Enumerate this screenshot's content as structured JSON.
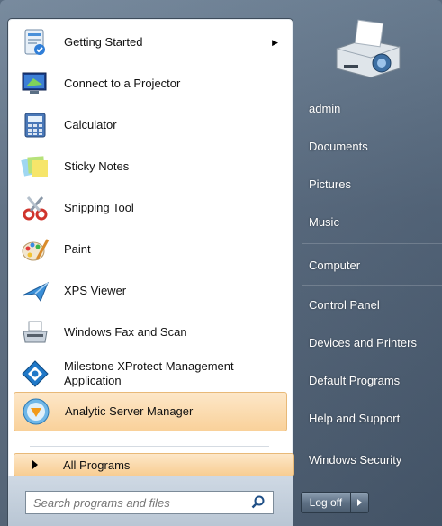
{
  "programs": [
    {
      "label": "Getting Started",
      "icon": "getting-started-icon",
      "has_submenu": true
    },
    {
      "label": "Connect to a Projector",
      "icon": "projector-icon"
    },
    {
      "label": "Calculator",
      "icon": "calculator-icon"
    },
    {
      "label": "Sticky Notes",
      "icon": "sticky-notes-icon"
    },
    {
      "label": "Snipping Tool",
      "icon": "snipping-tool-icon"
    },
    {
      "label": "Paint",
      "icon": "paint-icon"
    },
    {
      "label": "XPS Viewer",
      "icon": "xps-viewer-icon"
    },
    {
      "label": "Windows Fax and Scan",
      "icon": "fax-scan-icon"
    },
    {
      "label": "Milestone XProtect Management Application",
      "label_line1": "Milestone XProtect Management",
      "label_line2": "Application",
      "icon": "milestone-icon"
    },
    {
      "label": "Analytic Server Manager",
      "icon": "analytic-server-icon",
      "highlighted": true
    }
  ],
  "all_programs_label": "All Programs",
  "search": {
    "placeholder": "Search programs and files"
  },
  "right_items": [
    {
      "label": "admin"
    },
    {
      "label": "Documents"
    },
    {
      "label": "Pictures"
    },
    {
      "label": "Music"
    },
    {
      "label": "Computer"
    },
    {
      "label": "Control Panel"
    },
    {
      "label": "Devices and Printers"
    },
    {
      "label": "Default Programs"
    },
    {
      "label": "Help and Support"
    },
    {
      "label": "Windows Security"
    }
  ],
  "logoff_label": "Log off",
  "colors": {
    "highlight": "#f9d19a",
    "pane_bg": "#ffffff",
    "right_bg": "#55677c"
  }
}
